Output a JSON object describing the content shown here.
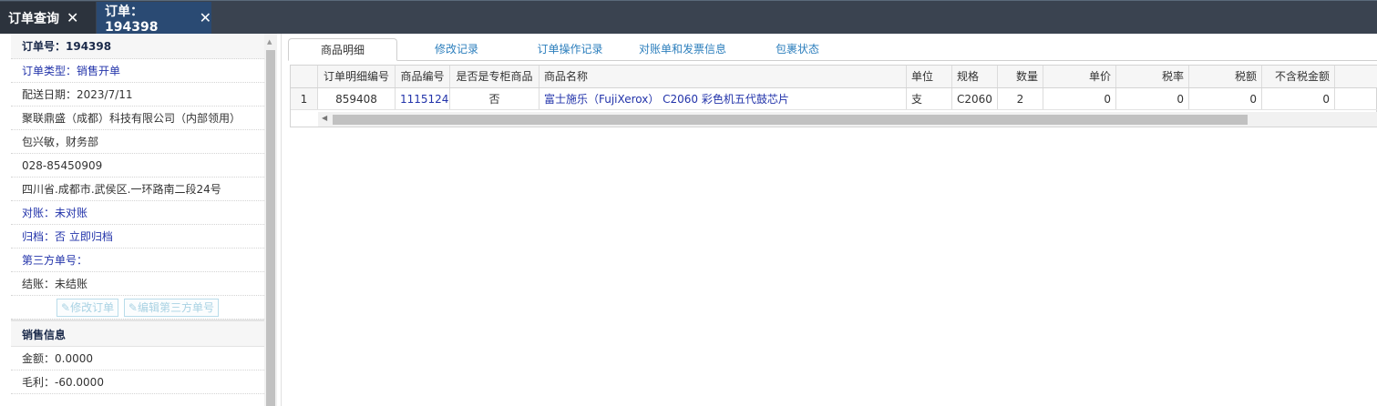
{
  "top_tabs": [
    {
      "label": "订单查询"
    },
    {
      "label": "订单：194398"
    }
  ],
  "order_panel": {
    "order_no": "订单号：194398",
    "order_type": "订单类型：销售开单",
    "delivery_date": "配送日期：2023/7/11",
    "company": "聚联鼎盛（成都）科技有限公司（内部领用）",
    "contact": "包兴敏，财务部",
    "phone": "028-85450909",
    "address": "四川省.成都市.武侯区.一环路南二段24号",
    "reconcile": "对账：未对账",
    "archive": "归档：否 立即归档",
    "third_party_no": "第三方单号：",
    "settlement": "结账：未结账",
    "btn_edit_order": "修改订单",
    "btn_edit_third": "编辑第三方单号"
  },
  "sales_info": {
    "title": "销售信息",
    "amount": "金额：0.0000",
    "gross_profit": "毛利：-60.0000"
  },
  "detail_tabs": [
    {
      "label": "商品明细",
      "active": true
    },
    {
      "label": "修改记录",
      "active": false
    },
    {
      "label": "订单操作记录",
      "active": false
    },
    {
      "label": "对账单和发票信息",
      "active": false
    },
    {
      "label": "包裹状态",
      "active": false
    }
  ],
  "table": {
    "headers": [
      "",
      "订单明细编号",
      "商品编号",
      "是否是专柜商品",
      "商品名称",
      "单位",
      "规格",
      "数量",
      "单价",
      "税率",
      "税额",
      "不含税金额"
    ],
    "rows": [
      [
        "1",
        "859408",
        "1115124",
        "否",
        "富士施乐（FujiXerox） C2060 彩色机五代鼓芯片",
        "支",
        "C2060",
        "2",
        "0",
        "0",
        "0",
        "0"
      ]
    ]
  },
  "colors": {
    "topbar": "#3a4350",
    "active_top_tab": "#2a4a73",
    "link_blue": "#2233aa",
    "tab_blue": "#2d7fbd"
  }
}
